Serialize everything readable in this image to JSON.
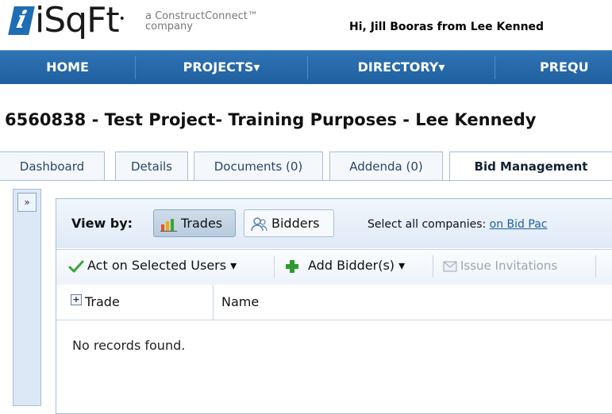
{
  "header": {
    "logo_mark": "i",
    "logo_text": "iSqFt",
    "tagline_line1": "a ConstructConnect™",
    "tagline_line2": "company",
    "greeting": "Hi, Jill Booras from Lee Kenned"
  },
  "nav": {
    "items": [
      {
        "label": "HOME"
      },
      {
        "label": "PROJECTS▾"
      },
      {
        "label": "DIRECTORY▾"
      },
      {
        "label": "PREQU"
      }
    ]
  },
  "project": {
    "title": "6560838 - Test Project- Training Purposes - Lee Kennedy"
  },
  "tabs": [
    {
      "label": "Dashboard"
    },
    {
      "label": "Details"
    },
    {
      "label": "Documents (0)"
    },
    {
      "label": "Addenda (0)"
    },
    {
      "label": "Bid Management"
    }
  ],
  "rail": {
    "toggle": "»"
  },
  "viewby": {
    "label": "View by:",
    "trades": "Trades",
    "bidders": "Bidders",
    "select_all_label": "Select all companies:",
    "select_all_link": "on Bid Pac"
  },
  "toolbar": {
    "act_label": "Act on Selected Users ▾",
    "add_label": "Add Bidder(s) ▾",
    "issue_label": "Issue Invitations"
  },
  "grid": {
    "expand": "+",
    "col_trade": "Trade",
    "col_name": "Name",
    "empty": "No records found."
  },
  "colors": {
    "nav_bg": "#2f74b5",
    "accent": "#1f6db3",
    "check_green": "#3aa43a",
    "plus_green": "#2d9b2d"
  }
}
